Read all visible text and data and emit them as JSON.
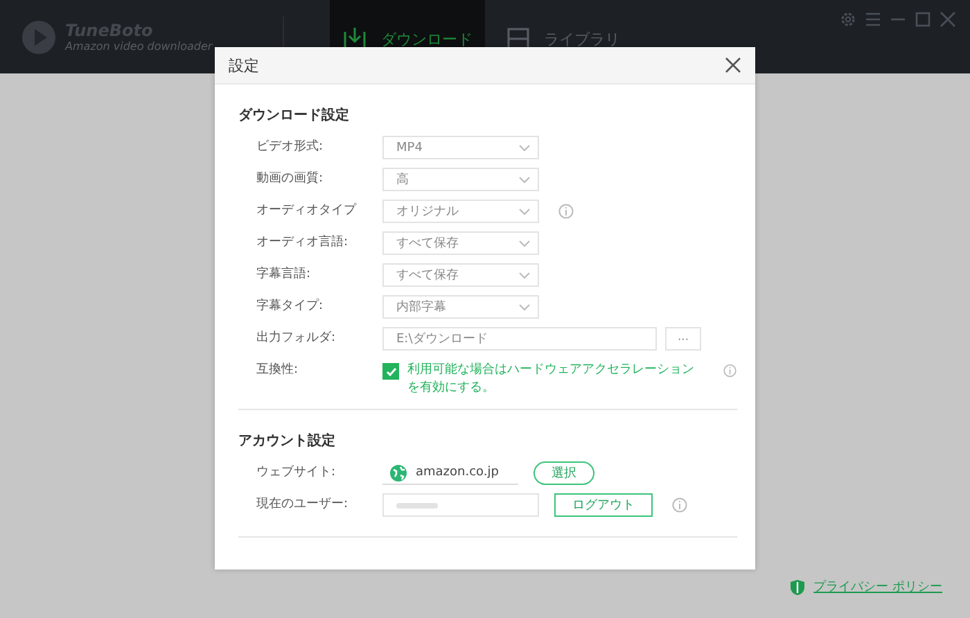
{
  "app": {
    "title": "TuneBoto",
    "subtitle": "Amazon video downloader",
    "tabs": [
      {
        "label": "ダウンロード",
        "selected": true
      },
      {
        "label": "ライブラリ",
        "selected": false
      }
    ]
  },
  "dialog": {
    "title": "設定",
    "sections": [
      {
        "title": "ダウンロード設定",
        "rows": [
          {
            "kind": "select",
            "label": "ビデオ形式:",
            "value": "MP4",
            "info": false
          },
          {
            "kind": "select",
            "label": "動画の画質:",
            "value": "高",
            "info": false
          },
          {
            "kind": "select",
            "label": "オーディオタイプ",
            "value": "オリジナル",
            "info": true
          },
          {
            "kind": "select",
            "label": "オーディオ言語:",
            "value": "すべて保存",
            "info": false
          },
          {
            "kind": "select",
            "label": "字幕言語:",
            "value": "すべて保存",
            "info": false
          },
          {
            "kind": "select",
            "label": "字幕タイプ:",
            "value": "内部字幕",
            "info": false
          },
          {
            "kind": "folder",
            "label": "出力フォルダ:",
            "value": "E:\\ダウンロード",
            "button": "···",
            "info": false
          },
          {
            "kind": "checkbox",
            "label": "互換性:",
            "text": "利用可能な場合はハードウェアアクセラレーションを有効にする。",
            "checked": true,
            "info": true
          }
        ]
      },
      {
        "title": "アカウント設定",
        "rows": [
          {
            "kind": "website",
            "label": "ウェブサイト:",
            "value": "amazon.co.jp",
            "button": "選択",
            "info": false
          },
          {
            "kind": "user",
            "label": "現在のユーザー:",
            "button": "ログアウト",
            "info": true
          }
        ]
      }
    ]
  },
  "privacy_link": "プライバシー ポリシー"
}
